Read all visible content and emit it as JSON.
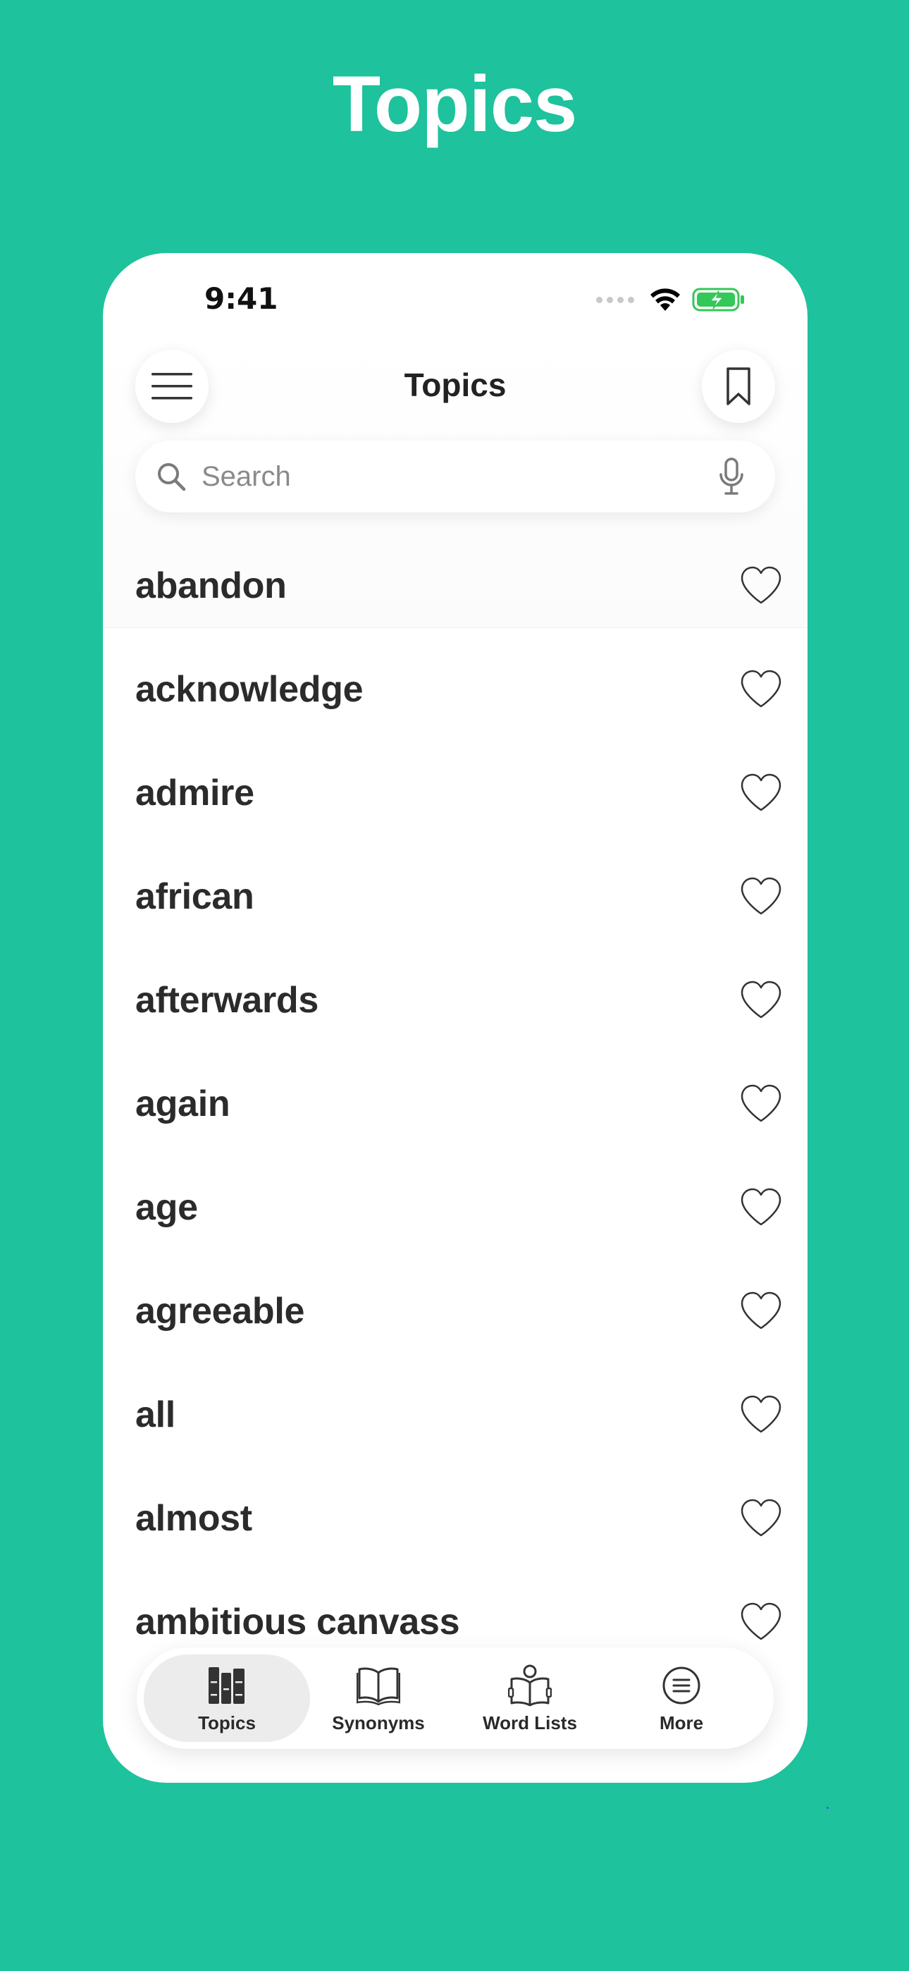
{
  "hero": {
    "title": "Topics"
  },
  "status_bar": {
    "time": "9:41"
  },
  "nav": {
    "title": "Topics"
  },
  "search": {
    "placeholder": "Search"
  },
  "words": [
    "abandon",
    "acknowledge",
    "admire",
    "african",
    "afterwards",
    "again",
    "age",
    "agreeable",
    "all",
    "almost",
    "ambitious canvass"
  ],
  "tabs": [
    {
      "label": "Topics",
      "icon": "books-icon",
      "active": true
    },
    {
      "label": "Synonyms",
      "icon": "open-book-icon",
      "active": false
    },
    {
      "label": "Word Lists",
      "icon": "reader-icon",
      "active": false
    },
    {
      "label": "More",
      "icon": "more-menu-icon",
      "active": false
    }
  ],
  "colors": {
    "background": "#1EC29C",
    "battery": "#34C759",
    "text": "#2b2b2b"
  }
}
